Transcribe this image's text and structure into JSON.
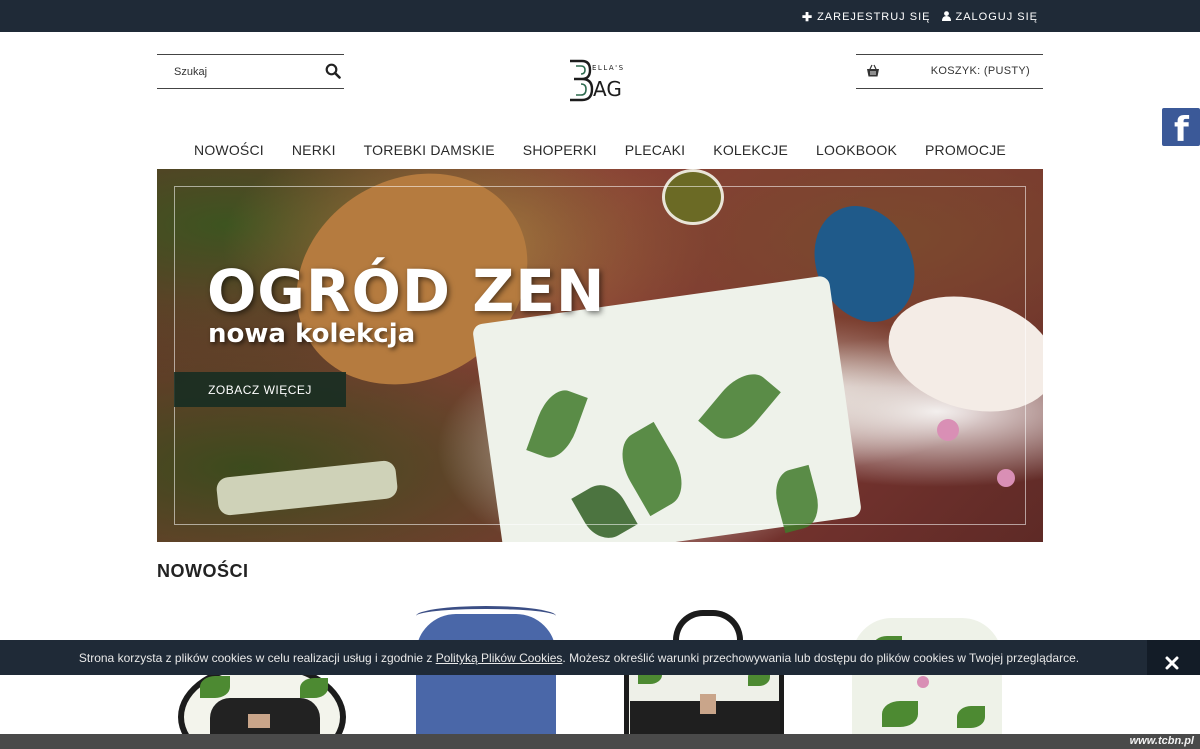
{
  "header": {
    "register_label": "ZAREJESTRUJ SIĘ",
    "login_label": "ZALOGUJ SIĘ"
  },
  "search": {
    "placeholder": "Szukaj",
    "icon": "search-icon"
  },
  "logo": {
    "small_text": "ELLA'S",
    "main_text": "AG",
    "letter": "B"
  },
  "cart": {
    "label": "KOSZYK: (PUSTY)",
    "icon": "basket-icon"
  },
  "social": {
    "facebook_letter": "f",
    "color": "#3b5998"
  },
  "nav": {
    "items": [
      {
        "label": "NOWOŚCI"
      },
      {
        "label": "NERKI"
      },
      {
        "label": "TOREBKI DAMSKIE"
      },
      {
        "label": "SHOPERKI"
      },
      {
        "label": "PLECAKI"
      },
      {
        "label": "KOLEKCJE"
      },
      {
        "label": "LOOKBOOK"
      },
      {
        "label": "PROMOCJE"
      }
    ]
  },
  "hero": {
    "title": "OGRÓD ZEN",
    "subtitle": "nowa kolekcja",
    "cta_label": "ZOBACZ WIĘCEJ"
  },
  "section": {
    "title": "NOWOŚCI"
  },
  "cookie": {
    "text_before": "Strona korzysta z plików cookies w celu realizacji usług i zgodnie z ",
    "link_label": "Polityką Plików Cookies",
    "text_after": ". Możesz określić warunki przechowywania lub dostępu do plików cookies w Twojej przeglądarce.",
    "close_icon": "close-icon"
  },
  "watermark": "www.tcbn.pl",
  "colors": {
    "topbar": "#1f2a37",
    "cookie_bar": "#1f2a37",
    "cta": "#162c22",
    "facebook": "#3b5998"
  }
}
